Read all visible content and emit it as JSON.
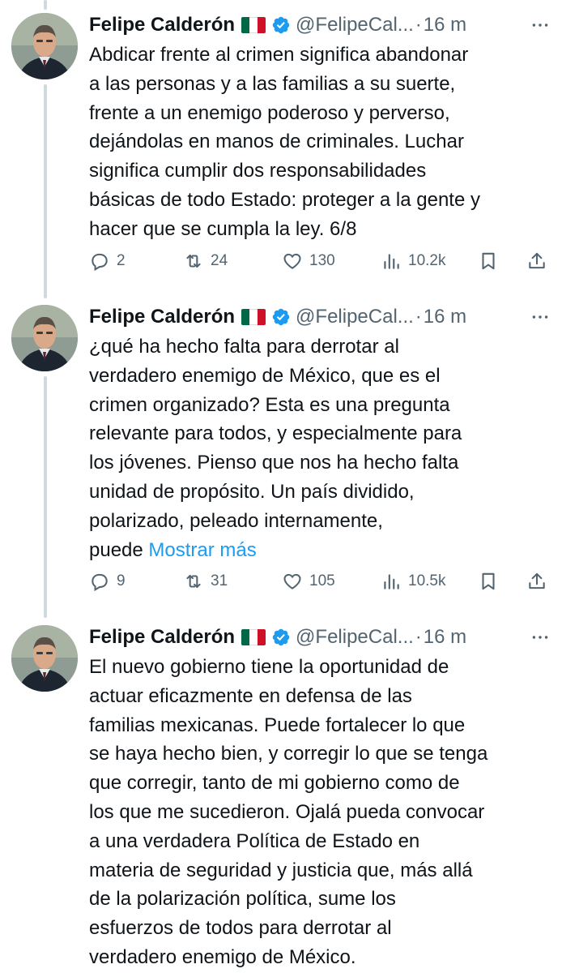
{
  "author": {
    "name": "Felipe Calderón",
    "handle": "@FelipeCal...",
    "separator": "·",
    "flag_colors": [
      "#006847",
      "#ffffff",
      "#ce1126"
    ],
    "verified_color": "#1d9bf0"
  },
  "tweets": [
    {
      "time": "16 m",
      "lines": [
        "Abdicar frente al crimen significa abandonar",
        "a las personas y a las familias a su suerte,",
        "frente a un enemigo poderoso y perverso,",
        "dejándolas en manos de criminales. Luchar",
        "significa cumplir dos responsabilidades",
        "básicas de todo Estado: proteger a la gente y",
        "hacer que se cumpla la ley. 6/8"
      ],
      "replies": "2",
      "retweets": "24",
      "likes": "130",
      "views": "10.2k"
    },
    {
      "time": "16 m",
      "lines": [
        "¿qué ha hecho falta para derrotar al",
        "verdadero enemigo de México, que es el",
        "crimen organizado? Esta es una pregunta",
        "relevante para todos, y especialmente para",
        "los jóvenes. Pienso que nos ha hecho falta",
        "unidad de propósito. Un país dividido,",
        "polarizado, peleado internamente,"
      ],
      "last_line_prefix": "puede ",
      "show_more": "Mostrar más",
      "replies": "9",
      "retweets": "31",
      "likes": "105",
      "views": "10.5k"
    },
    {
      "time": "16 m",
      "lines": [
        "El nuevo gobierno tiene la oportunidad de",
        "actuar eficazmente en defensa de las",
        "familias mexicanas. Puede fortalecer lo que",
        "se haya hecho bien, y corregir lo que se tenga",
        "que corregir, tanto de mi gobierno como de",
        "los que me sucedieron. Ojalá pueda convocar",
        "a una verdadera Política de Estado en",
        "materia de seguridad y justicia que, más allá",
        "de la polarización política, sume los",
        "esfuerzos de todos para derrotar al",
        "verdadero enemigo de México."
      ]
    }
  ]
}
